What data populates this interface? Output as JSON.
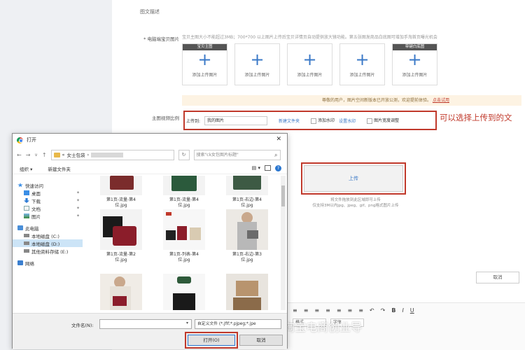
{
  "section_title": "图文描述",
  "main_image_label": "* 电脑端宝贝图片",
  "upload_hint": "宝贝主图大小不能超过3MB；700*700 以上图片上传后宝贝详情页自动提供放大镜功能。第五张图发商品白底图可增加手淘首页曝光机会",
  "slot_tags": [
    "宝贝主图",
    "",
    "",
    "",
    "带键白底图"
  ],
  "slot_add_label": "添加上传图片",
  "notice_text": "尊敬的用户，图片空间新版本已开放公测，欢迎提前体验。",
  "notice_link": "点击试用",
  "ratio_label": "主图视频比例",
  "upload_to_label": "上传到:",
  "upload_to_value": "我的图片",
  "new_folder_link": "新建文件夹",
  "watermark_label": "添加水印",
  "watermark_setting_link": "设置水印",
  "resize_label": "图片宽度调整",
  "annotation": "可以选择上传到的文",
  "upload_button": "上传",
  "upload_note_1": "将文件拖放到此区域即可上传",
  "upload_note_2": "仅支持3M以内jpg、jpeg、gif、png格式图片上传",
  "bg_cancel": "取消",
  "editor_tools": [
    "≡",
    "≡",
    "≡",
    "≡",
    "≡",
    "≡",
    "≡",
    "↶",
    "↷",
    "B",
    "I",
    "U"
  ],
  "editor_select_1": "格式",
  "editor_select_2": "字体",
  "watermark_text": "知乎 @淘宝电商创业导",
  "dialog": {
    "title": "打开",
    "nav_back": "←",
    "nav_forward": "→",
    "nav_down": "∨",
    "nav_up": "↑",
    "path_root": "«",
    "path_folder": "女士包袋",
    "path_arrow": "›",
    "search_placeholder": "搜索\"ck女包图片标题\"",
    "organize": "组织 ▾",
    "new_folder": "新建文件夹",
    "tree": [
      {
        "label": "快速访问",
        "icon": "star",
        "level": 0
      },
      {
        "label": "桌面",
        "icon": "desktop",
        "level": 1,
        "pin": true
      },
      {
        "label": "下载",
        "icon": "download",
        "level": 1,
        "pin": true
      },
      {
        "label": "文档",
        "icon": "document",
        "level": 1,
        "pin": true
      },
      {
        "label": "图片",
        "icon": "pictures",
        "level": 1,
        "pin": true
      },
      {
        "label": "此电脑",
        "icon": "computer",
        "level": 0
      },
      {
        "label": "本地磁盘 (C:)",
        "icon": "drive",
        "level": 1
      },
      {
        "label": "本地磁盘 (D:)",
        "icon": "drive",
        "level": 1,
        "selected": true
      },
      {
        "label": "其他资料存储 (E:)",
        "icon": "drive",
        "level": 1
      },
      {
        "label": "网络",
        "icon": "network",
        "level": 0
      }
    ],
    "files": [
      {
        "name": "第1页-流量-第4",
        "name2": "位.jpg"
      },
      {
        "name": "第1页-流量-第4",
        "name2": "位.jpg"
      },
      {
        "name": "第1页-右边-第4",
        "name2": "位.jpg"
      },
      {
        "name": "第1页-流量-第2",
        "name2": "位.jpg"
      },
      {
        "name": "第1页-列表-第4",
        "name2": "位.jpg"
      },
      {
        "name": "第1页-右边-第3",
        "name2": "位.jpg"
      },
      {
        "name": "",
        "name2": ""
      },
      {
        "name": "",
        "name2": ""
      },
      {
        "name": "",
        "name2": ""
      }
    ],
    "filename_label": "文件名(N):",
    "filename_value": "",
    "filter": "自定义文件 (*.jfif;*.pjpeg;*.jpe",
    "open_button": "打开(O)",
    "cancel_button": "取消"
  }
}
